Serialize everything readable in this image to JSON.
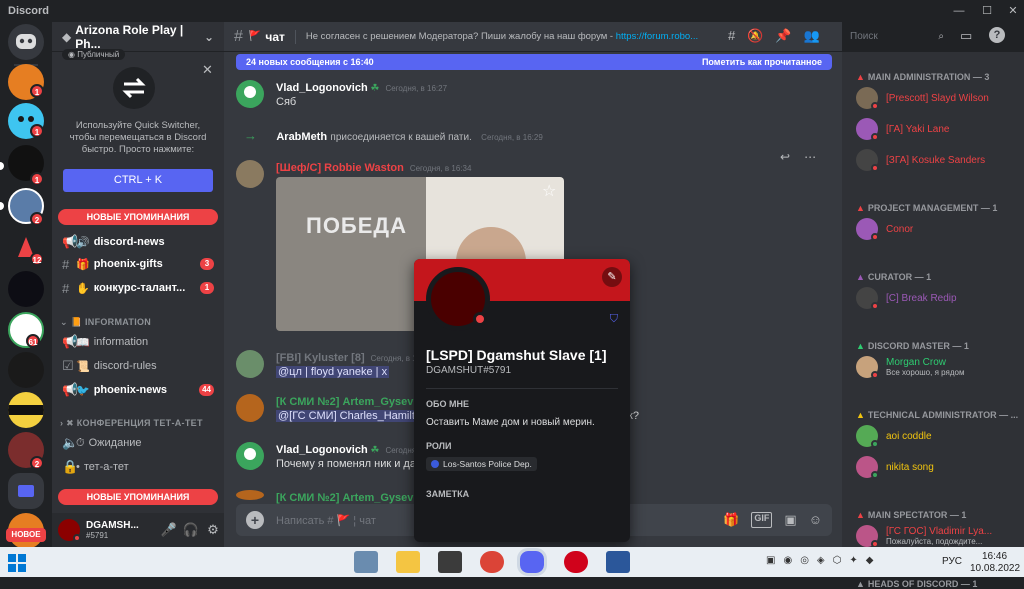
{
  "app": {
    "title": "Discord"
  },
  "window": {
    "min": "—",
    "max": "☐",
    "close": "✕"
  },
  "guild_badges": [
    "1",
    "1",
    "1",
    "2",
    "12",
    "61",
    "2"
  ],
  "guild_new_label": "НОВОЕ",
  "server": {
    "name": "Arizona Role Play | Ph...",
    "public_label": "Публичный",
    "switcher_text": "Используйте Quick Switcher, чтобы перемещаться в Discord быстро. Просто нажмите:",
    "switcher_key": "CTRL + K",
    "mentions_label": "НОВЫЕ УПОМИНАНИЯ",
    "channels": [
      {
        "name": "discord-news",
        "count": ""
      },
      {
        "name": "phoenix-gifts",
        "count": "3"
      },
      {
        "name": "конкурс-талант...",
        "count": "1"
      }
    ],
    "info_category": "INFORMATION",
    "info_channels": [
      {
        "name": "information",
        "count": ""
      },
      {
        "name": "discord-rules",
        "count": ""
      },
      {
        "name": "phoenix-news",
        "count": "44"
      }
    ],
    "conf_category": "КОНФЕРЕНЦИЯ ТЕТ-А-ТЕТ",
    "conf_channels": [
      {
        "name": "Ожидание"
      },
      {
        "name": "тет-а-тет"
      }
    ]
  },
  "user": {
    "name": "DGAMSH...",
    "tag": "#5791"
  },
  "channel": {
    "name": "чат",
    "topic": "Не согласен с решением Модератора? Пиши жалобу на наш форум - ",
    "topic_link": "https://forum.robo...",
    "new_messages": "24 новых сообщения с 16:40",
    "mark_read": "Пометить как прочитанное",
    "composer_placeholder": "Написать #",
    "composer_channel": "чат",
    "search_placeholder": "Поиск"
  },
  "messages": [
    {
      "author": "Vlad_Logonovich",
      "time": "Сегодня, в 16:27",
      "text": "Сяб"
    },
    {
      "author": "ArabMeth",
      "join_text": "присоединяется к вашей пати.",
      "time": "Сегодня, в 16:29"
    },
    {
      "author": "[Шеф/С] Robbie Waston",
      "time": "Сегодня, в 16:34",
      "image_text": "ПОБЕДА"
    },
    {
      "author": "[FBI] Kyluster [8]",
      "time": "Сегодня, в 16",
      "text": "@цл | floyd yaneke | x"
    },
    {
      "author": "[К СМИ №2] Artem_Gysev",
      "time": "",
      "text": "@[ГС СМИ] Charles_Hamilt",
      "tail": "к?"
    },
    {
      "author": "Vlad_Logonovich",
      "time": "Сегодня",
      "text": "Почему я поменял ник и да"
    },
    {
      "author": "[К СМИ №2] Artem_Gysev",
      "time": ""
    }
  ],
  "popout": {
    "name": "[LSPD] Dgamshut Slave [1]",
    "tag": "DGAMSHUT#5791",
    "about_label": "ОБО МНЕ",
    "about_text": "Оставить Маме дом и новый мерин.",
    "roles_label": "РОЛИ",
    "role": "Los-Santos Police Dep.",
    "note_label": "ЗАМЕТКА"
  },
  "members": {
    "groups": [
      {
        "title": "MAIN ADMINISTRATION — 3",
        "members": [
          {
            "name": "[Prescott] Slayd Wilson",
            "color": "#ed4245"
          },
          {
            "name": "[ГА] Yaki Lane",
            "color": "#ed4245"
          },
          {
            "name": "[ЗГА] Kosuke Sanders",
            "color": "#ed4245"
          }
        ]
      },
      {
        "title": "PROJECT MANAGEMENT — 1",
        "members": [
          {
            "name": "Conor",
            "color": "#ed4245"
          }
        ]
      },
      {
        "title": "CURATOR — 1",
        "members": [
          {
            "name": "[C] Break Redip",
            "color": "#9b59b6"
          }
        ]
      },
      {
        "title": "DISCORD MASTER — 1",
        "members": [
          {
            "name": "Morgan Crow",
            "status": "Все хорошо, я рядом",
            "color": "#2ecc71"
          }
        ]
      },
      {
        "title": "TECHNICAL ADMINISTRATOR — ...",
        "members": [
          {
            "name": "aoi coddle",
            "color": "#f1c40f"
          },
          {
            "name": "nikita song",
            "color": "#f1c40f"
          }
        ]
      },
      {
        "title": "MAIN SPECTATOR — 1",
        "members": [
          {
            "name": "[ГС ГОС] Vladimir Lya...",
            "status": "Пожалуйста, подождите...",
            "color": "#ed4245"
          }
        ]
      },
      {
        "title": "HEADS OF DISCORD — 1",
        "members": []
      }
    ]
  },
  "taskbar": {
    "lang": "РУС",
    "time": "16:46",
    "date": "10.08.2022"
  },
  "colors": {
    "accent": "#5865f2",
    "danger": "#ed4245",
    "online": "#3ba55d"
  }
}
